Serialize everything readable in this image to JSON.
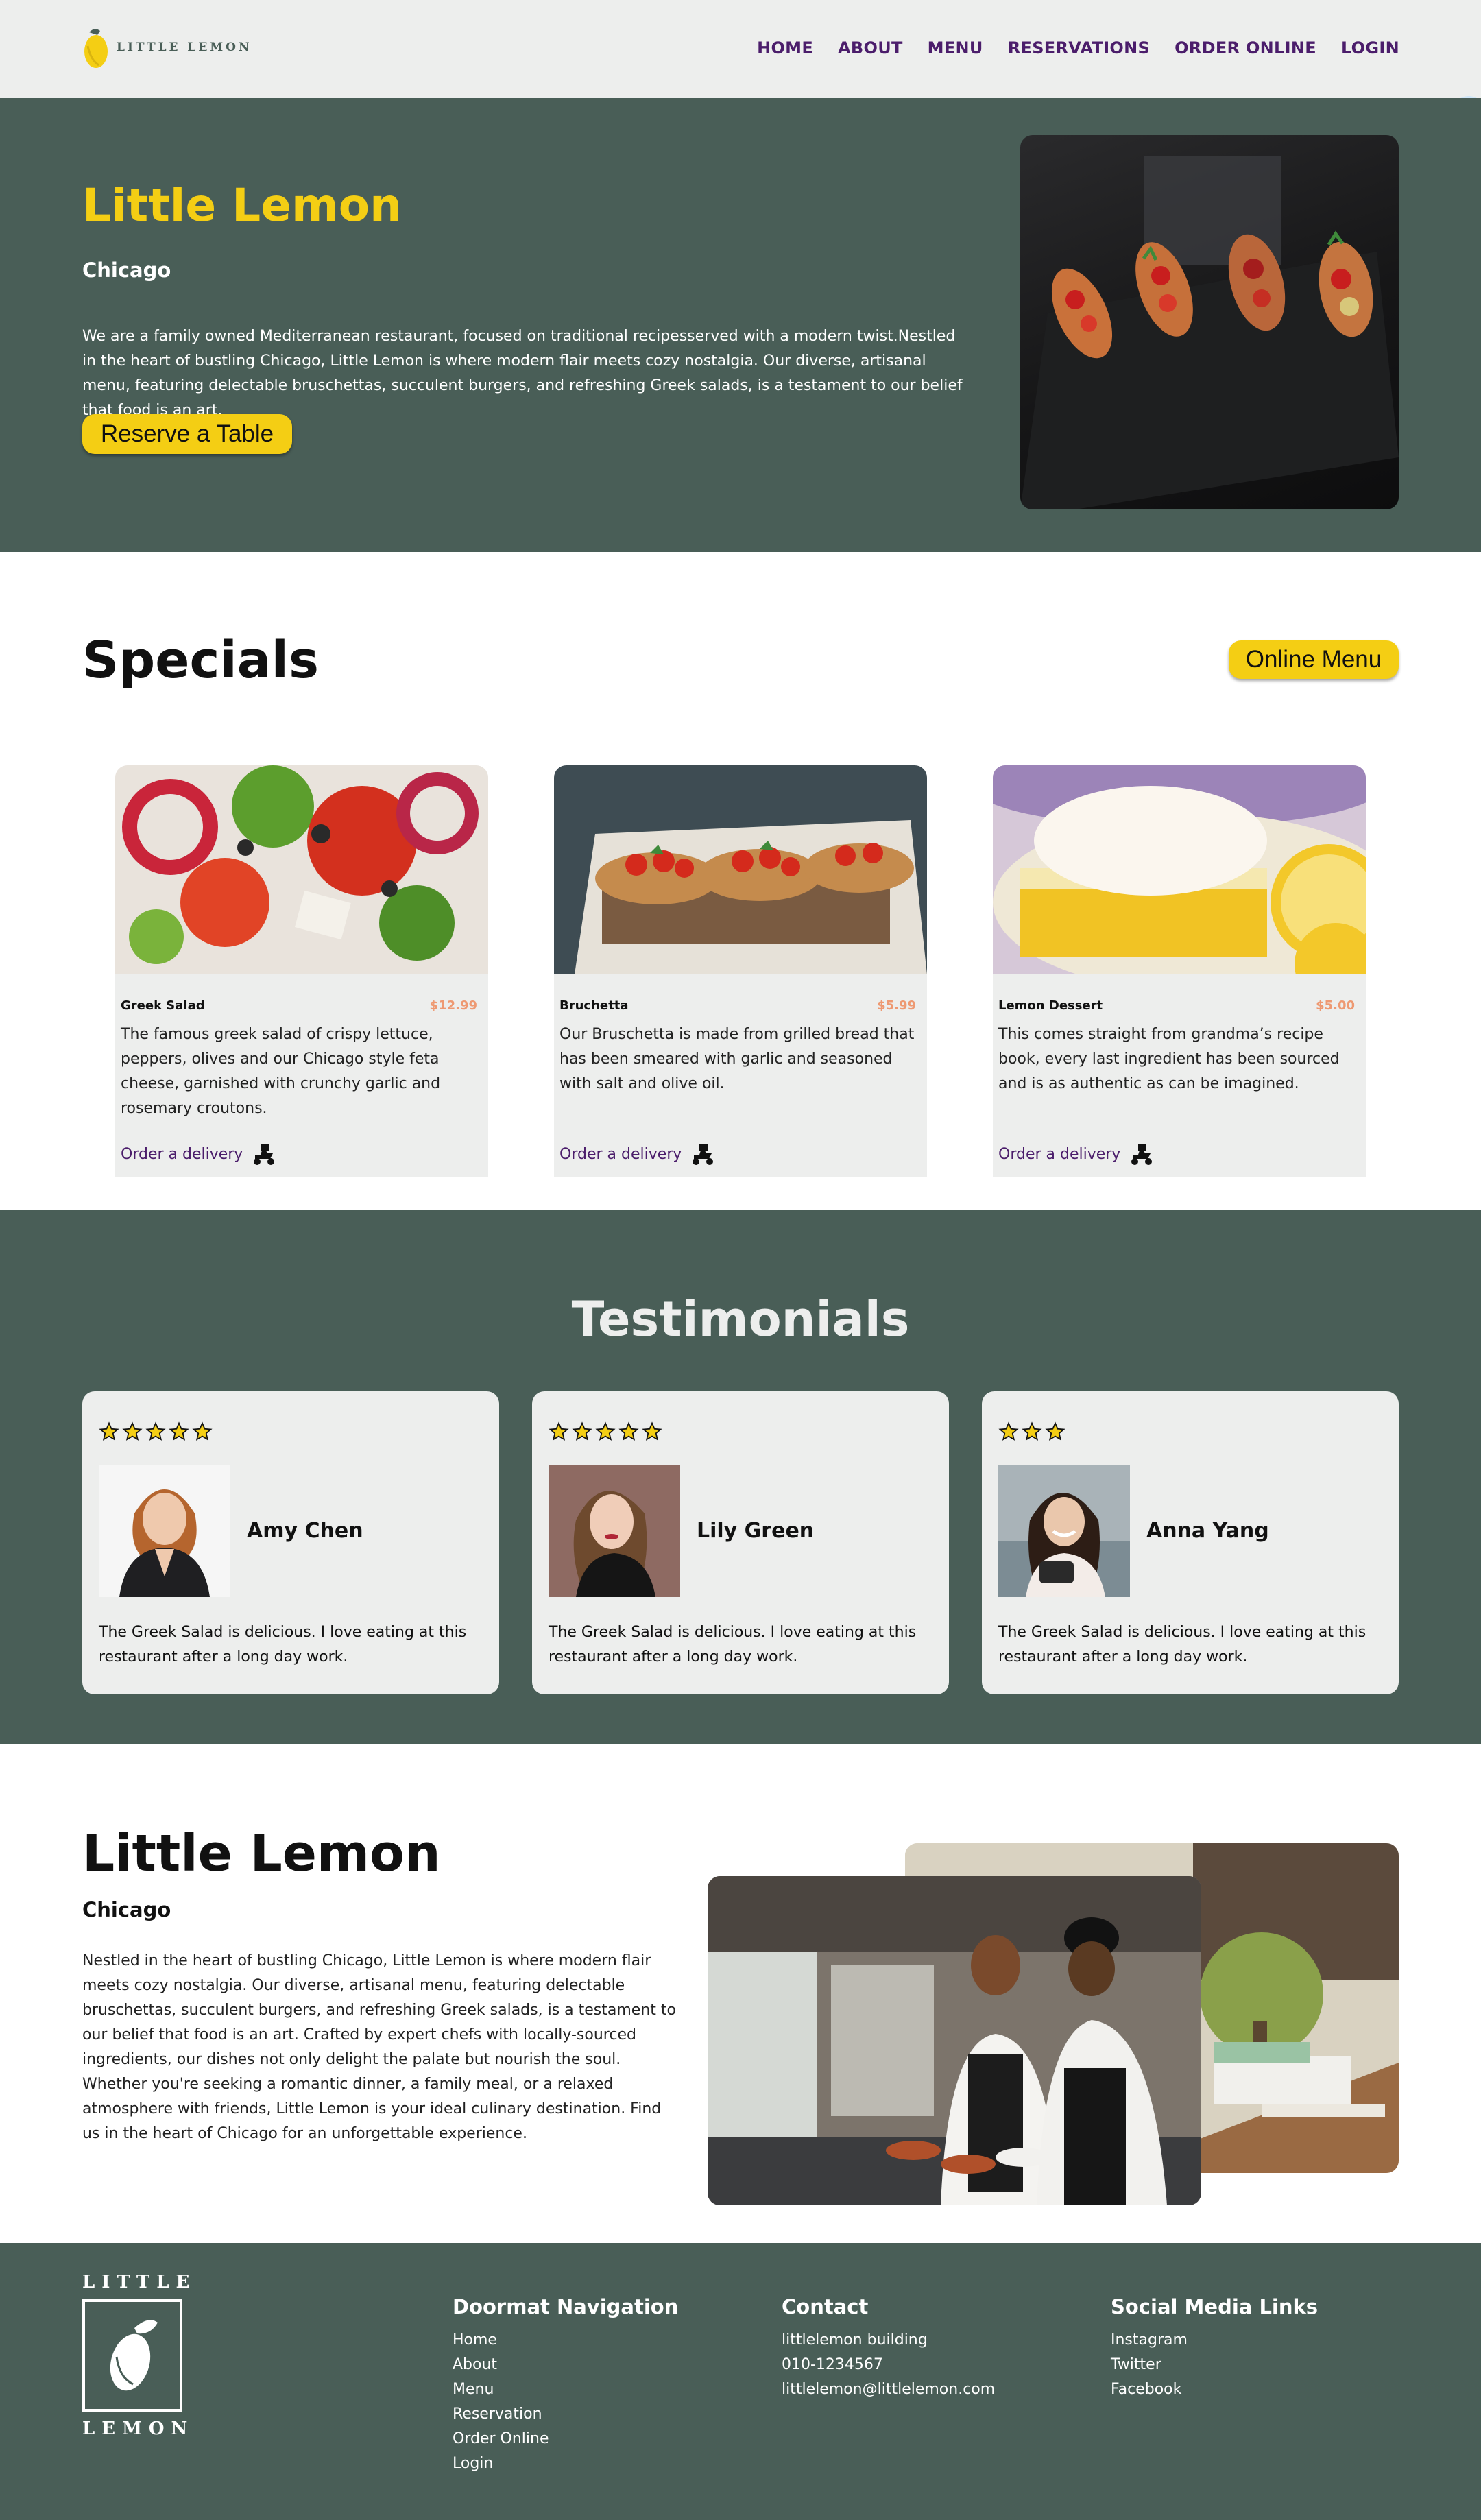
{
  "brand": {
    "logo_text": "LITTLE LEMON",
    "colors": {
      "green": "#495e57",
      "yellow": "#f4ce14",
      "purple": "#4b1d6b",
      "salmon": "#ee9972",
      "light": "#edeeed"
    }
  },
  "nav": {
    "items": [
      "HOME",
      "ABOUT",
      "MENU",
      "RESERVATIONS",
      "ORDER ONLINE",
      "LOGIN"
    ],
    "side_icon": "command-icon"
  },
  "hero": {
    "title": "Little Lemon",
    "city": "Chicago",
    "description": "We are a family owned Mediterranean restaurant, focused on traditional recipesserved with a modern twist.Nestled in the heart of bustling Chicago, Little Lemon is where modern flair meets cozy nostalgia. Our diverse, artisanal menu, featuring delectable bruschettas, succulent burgers, and refreshing Greek salads, is a testament to our belief that food is an art.",
    "button": "Reserve a Table"
  },
  "specials": {
    "title": "Specials",
    "button": "Online Menu",
    "cards": [
      {
        "name": "Greek Salad",
        "price": "$12.99",
        "description": "The famous greek salad of crispy lettuce, peppers, olives and our Chicago style feta cheese, garnished with crunchy garlic and rosemary croutons.",
        "order": "Order a delivery"
      },
      {
        "name": "Bruchetta",
        "price": "$5.99",
        "description": "Our Bruschetta is made from grilled bread that has been smeared with garlic and seasoned with salt and olive oil.",
        "order": "Order a delivery"
      },
      {
        "name": "Lemon Dessert",
        "price": "$5.00",
        "description": "This comes straight from grandma’s recipe book, every last ingredient has been sourced and is as authentic as can be imagined.",
        "order": "Order a delivery"
      }
    ]
  },
  "testimonials": {
    "title": "Testimonials",
    "items": [
      {
        "name": "Amy Chen",
        "rating": 5,
        "quote": "The Greek Salad is delicious. I love eating at this restaurant after a long day work."
      },
      {
        "name": "Lily Green",
        "rating": 5,
        "quote": "The Greek Salad is delicious. I love eating at this restaurant after a long day work."
      },
      {
        "name": "Anna Yang",
        "rating": 3,
        "quote": "The Greek Salad is delicious. I love eating at this restaurant after a long day work."
      }
    ]
  },
  "about": {
    "title": "Little Lemon",
    "city": "Chicago",
    "description": "Nestled in the heart of bustling Chicago, Little Lemon is where modern flair meets cozy nostalgia. Our diverse, artisanal menu, featuring delectable bruschettas, succulent burgers, and refreshing Greek salads, is a testament to our belief that food is an art. Crafted by expert chefs with locally-sourced ingredients, our dishes not only delight the palate but nourish the soul. Whether you're seeking a romantic dinner, a family meal, or a relaxed atmosphere with friends, Little Lemon is your ideal culinary destination. Find us in the heart of Chicago for an unforgettable experience."
  },
  "footer": {
    "logo_top": "LITTLE",
    "logo_bottom": "LEMON",
    "nav_title": "Doormat Navigation",
    "nav_links": [
      "Home",
      "About",
      "Menu",
      "Reservation",
      "Order Online",
      "Login"
    ],
    "contact_title": "Contact",
    "contact": [
      "littlelemon building",
      "010-1234567",
      "littlelemon@littlelemon.com"
    ],
    "social_title": "Social Media Links",
    "social": [
      "Instagram",
      "Twitter",
      "Facebook"
    ]
  }
}
